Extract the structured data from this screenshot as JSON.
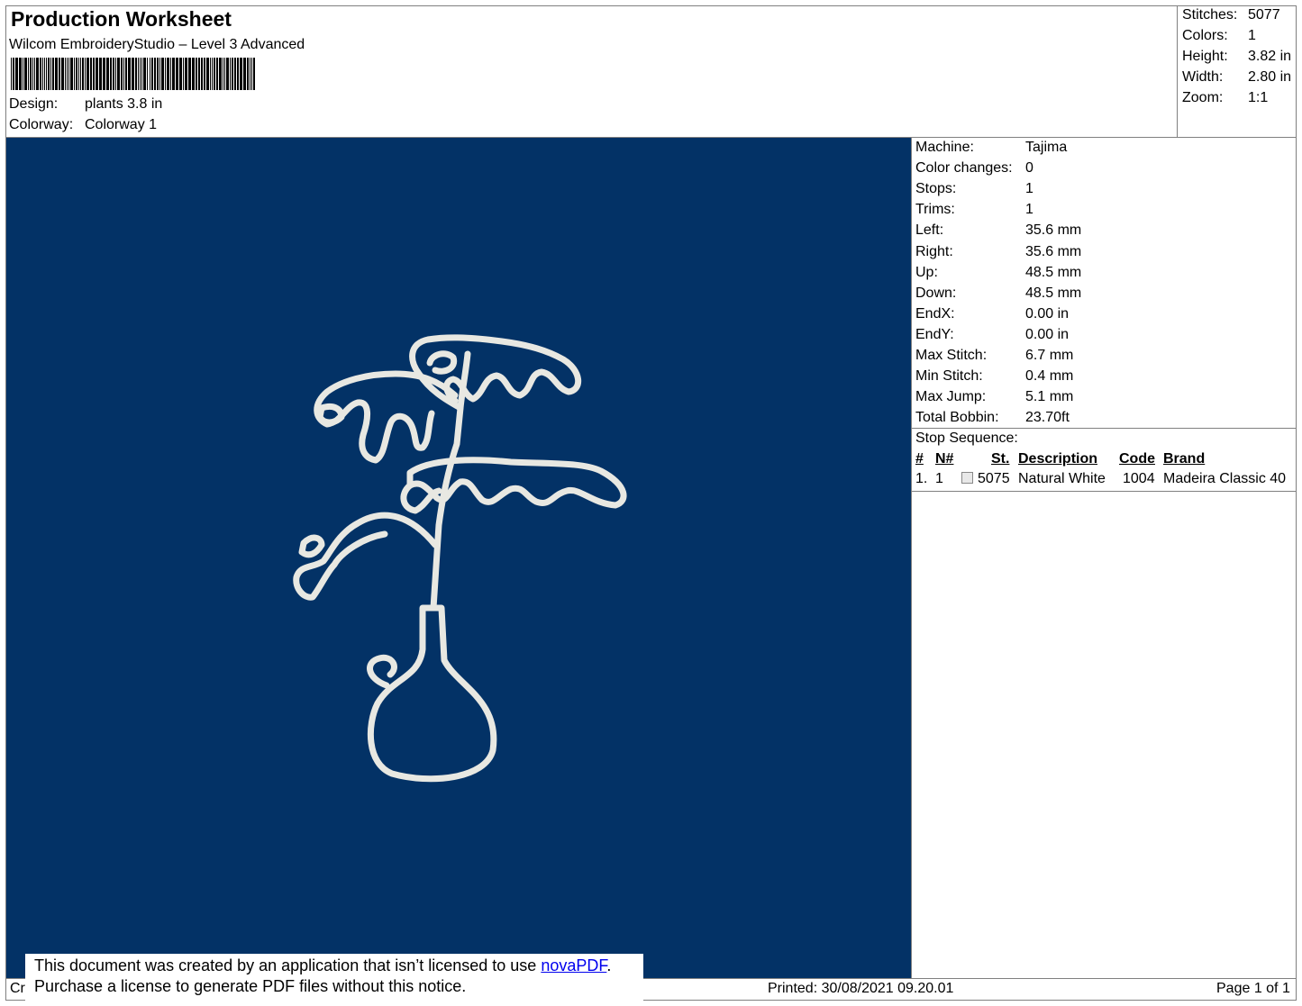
{
  "header": {
    "title": "Production Worksheet",
    "subtitle": "Wilcom EmbroideryStudio – Level 3 Advanced",
    "design_label": "Design:",
    "design_value": "plants 3.8 in",
    "colorway_label": "Colorway:",
    "colorway_value": "Colorway 1"
  },
  "stats": [
    {
      "label": "Stitches:",
      "value": "5077"
    },
    {
      "label": "Colors:",
      "value": "1"
    },
    {
      "label": "Height:",
      "value": "3.82 in"
    },
    {
      "label": "Width:",
      "value": "2.80 in"
    },
    {
      "label": "Zoom:",
      "value": "1:1"
    }
  ],
  "design_preview": {
    "background_color": "#033266",
    "thread_color": "#e8e8e2"
  },
  "machine_info": [
    {
      "label": "Machine:",
      "value": "Tajima"
    },
    {
      "label": "Color changes:",
      "value": "0"
    },
    {
      "label": "Stops:",
      "value": "1"
    },
    {
      "label": "Trims:",
      "value": "1"
    },
    {
      "label": "Left:",
      "value": "35.6 mm"
    },
    {
      "label": "Right:",
      "value": "35.6 mm"
    },
    {
      "label": "Up:",
      "value": "48.5 mm"
    },
    {
      "label": "Down:",
      "value": "48.5 mm"
    },
    {
      "label": "EndX:",
      "value": "0.00 in"
    },
    {
      "label": "EndY:",
      "value": "0.00 in"
    },
    {
      "label": "Max Stitch:",
      "value": "6.7 mm"
    },
    {
      "label": "Min Stitch:",
      "value": "0.4 mm"
    },
    {
      "label": "Max Jump:",
      "value": "5.1 mm"
    },
    {
      "label": "Total Bobbin:",
      "value": "23.70ft"
    }
  ],
  "stop_sequence": {
    "label": "Stop Sequence:",
    "columns": [
      "#",
      "N#",
      "St.",
      "Description",
      "Code",
      "Brand"
    ],
    "rows": [
      {
        "index": "1.",
        "n": "1",
        "stitches": "5075",
        "description": "Natural White",
        "code": "1004",
        "brand": "Madeira Classic 40"
      }
    ]
  },
  "footer": {
    "left_text": "Cr",
    "printed": "Printed: 30/08/2021 09.20.01",
    "page": "Page 1 of 1"
  },
  "notice": {
    "line1_prefix": "This document was created by an application that isn’t licensed to use ",
    "link_text": "novaPDF",
    "line1_suffix": ".",
    "line2": "Purchase a license to generate PDF files without this notice."
  }
}
